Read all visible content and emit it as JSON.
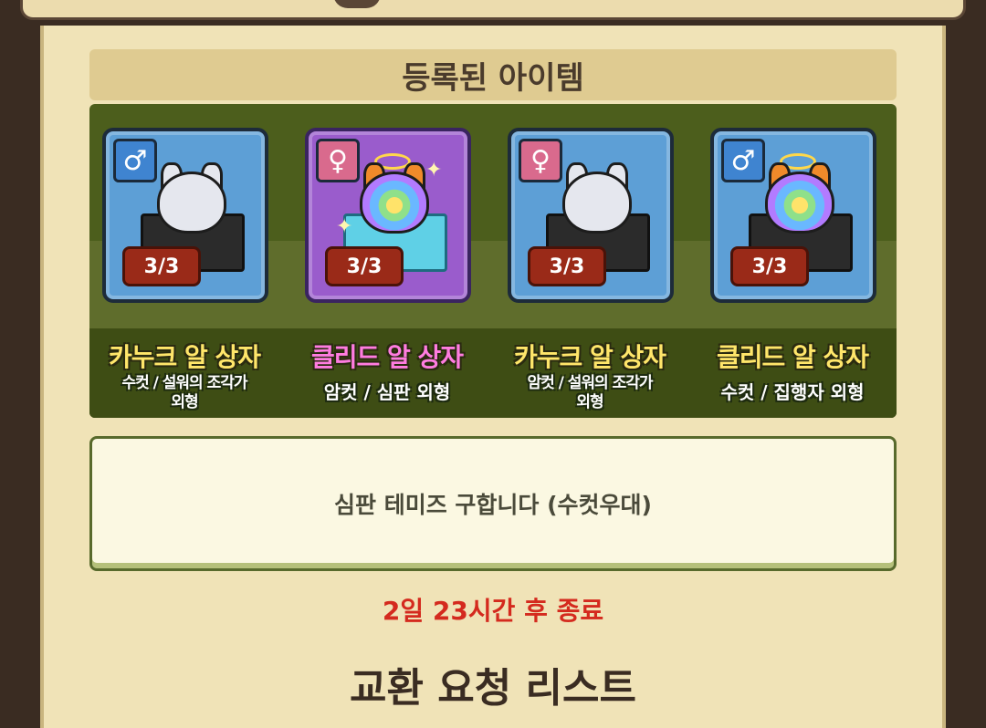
{
  "section_title": "등록된 아이템",
  "items": [
    {
      "gender_symbol": "♂",
      "count": "3/3",
      "name": "카누크 알 상자",
      "sub1": "수컷 / 설워의 조각가",
      "sub2": "외형"
    },
    {
      "gender_symbol": "♀",
      "count": "3/3",
      "name": "클리드 알 상자",
      "sub1": "암컷 / 심판 외형",
      "sub2": ""
    },
    {
      "gender_symbol": "♀",
      "count": "3/3",
      "name": "카누크 알 상자",
      "sub1": "암컷 / 설워의 조각가",
      "sub2": "외형"
    },
    {
      "gender_symbol": "♂",
      "count": "3/3",
      "name": "클리드 알 상자",
      "sub1": "수컷 / 집행자 외형",
      "sub2": ""
    }
  ],
  "message": "심판 테미즈 구합니다 (수컷우대)",
  "timer": "2일 23시간 후 종료",
  "list_title": "교환 요청 리스트",
  "colors": {
    "timer": "#d42a1e",
    "name_yellow": "#ffe66a",
    "name_pink": "#ff7ce0"
  }
}
